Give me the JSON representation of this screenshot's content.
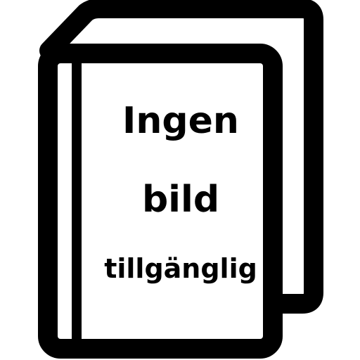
{
  "icon": "book-icon",
  "colors": {
    "stroke": "#000000",
    "background": "#ffffff"
  },
  "message": {
    "line1": "Ingen",
    "line2": "bild",
    "line3": "tillgänglig"
  }
}
